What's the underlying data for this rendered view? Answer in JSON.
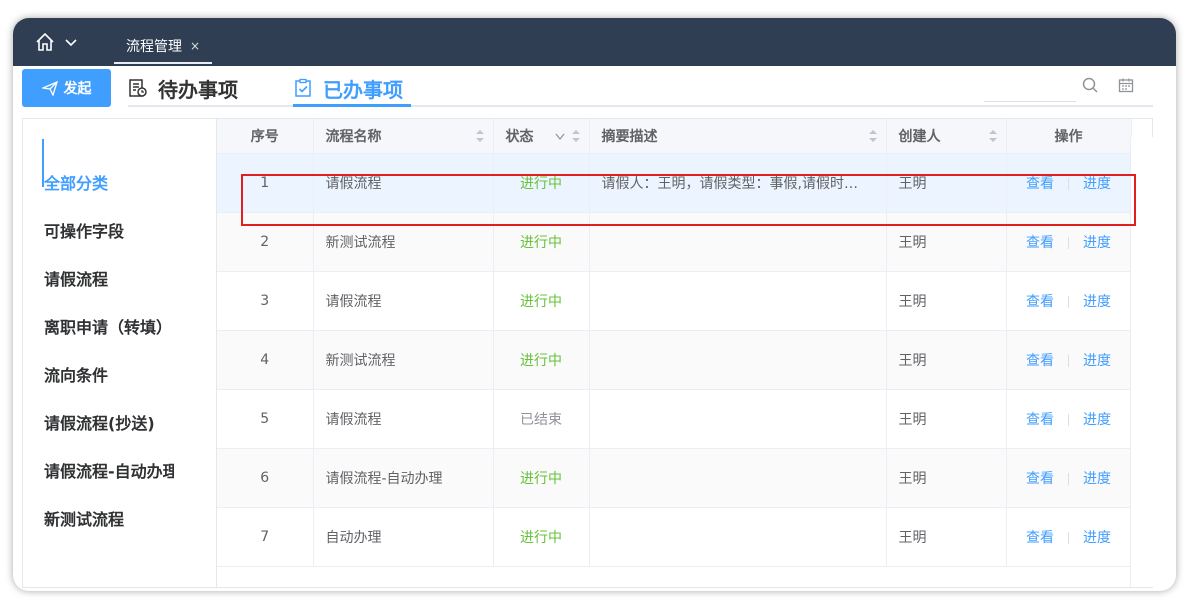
{
  "topbar": {
    "tab_label": "流程管理",
    "tab_close": "×"
  },
  "toolbar": {
    "launch_label": "发起",
    "todo_tab": "待办事项",
    "done_tab": "已办事项",
    "search_placeholder": ""
  },
  "sidebar": {
    "categories": [
      {
        "label": "全部分类"
      },
      {
        "label": "可操作字段"
      },
      {
        "label": "请假流程"
      },
      {
        "label": "离职申请（转填）"
      },
      {
        "label": "流向条件"
      },
      {
        "label": "请假流程(抄送)"
      },
      {
        "label": "请假流程-自动办理"
      },
      {
        "label": "新测试流程"
      }
    ]
  },
  "table": {
    "headers": {
      "index": "序号",
      "name": "流程名称",
      "status": "状态",
      "summary": "摘要描述",
      "creator": "创建人",
      "action": "操作"
    },
    "action_view": "查看",
    "action_progress": "进度",
    "rows": [
      {
        "index": "1",
        "name": "请假流程",
        "status": "进行中",
        "summary": "请假人：王明，请假类型：事假,请假时…",
        "creator": "王明"
      },
      {
        "index": "2",
        "name": "新测试流程",
        "status": "进行中",
        "summary": "",
        "creator": "王明"
      },
      {
        "index": "3",
        "name": "请假流程",
        "status": "进行中",
        "summary": "",
        "creator": "王明"
      },
      {
        "index": "4",
        "name": "新测试流程",
        "status": "进行中",
        "summary": "",
        "creator": "王明"
      },
      {
        "index": "5",
        "name": "请假流程",
        "status": "已结束",
        "summary": "",
        "creator": "王明"
      },
      {
        "index": "6",
        "name": "请假流程-自动办理",
        "status": "进行中",
        "summary": "",
        "creator": "王明"
      },
      {
        "index": "7",
        "name": "自动办理",
        "status": "进行中",
        "summary": "",
        "creator": "王明"
      }
    ]
  },
  "colors": {
    "accent": "#409eff",
    "running": "#67c23a",
    "ended": "#909399",
    "topbar": "#2f3e52",
    "highlight": "#e02020"
  }
}
